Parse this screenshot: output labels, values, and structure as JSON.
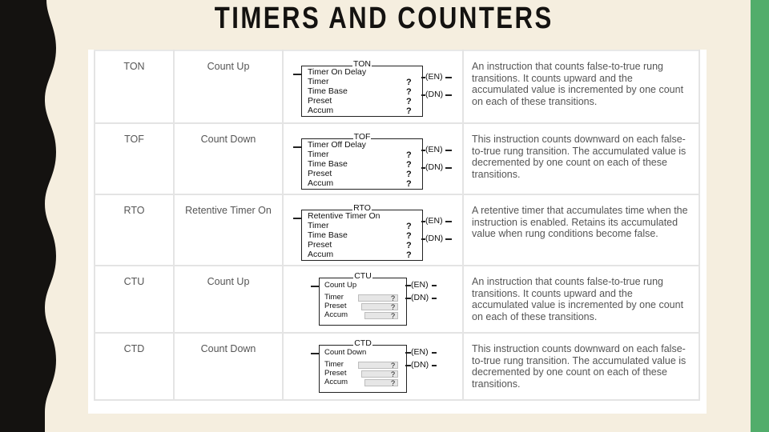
{
  "title": "TIMERS AND COUNTERS",
  "colors": {
    "background": "#f5eedf",
    "accent_bar": "#52ad6b",
    "left_strip": "#141210"
  },
  "rows": [
    {
      "code": "TON",
      "name": "Count Up",
      "block": {
        "header": "TON",
        "subtitle": "Timer On Delay",
        "fields": [
          "Timer",
          "Time Base",
          "Preset",
          "Accum"
        ],
        "values": [
          "?",
          "?",
          "?",
          "?"
        ],
        "outputs": [
          "(EN)",
          "(DN)"
        ]
      },
      "description": "An instruction that counts false-to-true rung transitions. It counts upward and the accumulated value is incremented by one count on each of these transitions."
    },
    {
      "code": "TOF",
      "name": "Count Down",
      "block": {
        "header": "TOF",
        "subtitle": "Timer Off Delay",
        "fields": [
          "Timer",
          "Time Base",
          "Preset",
          "Accum"
        ],
        "values": [
          "?",
          "?",
          "?",
          "?"
        ],
        "outputs": [
          "(EN)",
          "(DN)"
        ]
      },
      "description": "This instruction counts downward on each false-to-true rung transition. The accumulated value is decremented by one count on each of these transitions."
    },
    {
      "code": "RTO",
      "name": "Retentive Timer On",
      "block": {
        "header": "RTO",
        "subtitle": "Retentive Timer On",
        "fields": [
          "Timer",
          "Time Base",
          "Preset",
          "Accum"
        ],
        "values": [
          "?",
          "?",
          "?",
          "?"
        ],
        "outputs": [
          "(EN)",
          "(DN)"
        ]
      },
      "description": "A retentive timer that accumulates time when the instruction is enabled. Retains its accumulated value when rung conditions become false."
    },
    {
      "code": "CTU",
      "name": "Count Up",
      "block": {
        "header": "CTU",
        "subtitle": "Count Up",
        "fields": [
          "Timer",
          "Preset",
          "Accum"
        ],
        "values": [
          "?",
          "?",
          "?"
        ],
        "outputs": [
          "(EN)",
          "(DN)"
        ]
      },
      "description": "An instruction that counts false-to-true rung transitions. It counts upward and the accumulated value is incremented by one count on each of these transitions."
    },
    {
      "code": "CTD",
      "name": "Count Down",
      "block": {
        "header": "CTD",
        "subtitle": "Count Down",
        "fields": [
          "Timer",
          "Preset",
          "Accum"
        ],
        "values": [
          "?",
          "?",
          "?"
        ],
        "outputs": [
          "(EN)",
          "(DN)"
        ]
      },
      "description": "This instruction counts downward on each false-to-true rung transition. The accumulated value is decremented by one count on each of these transitions."
    }
  ]
}
